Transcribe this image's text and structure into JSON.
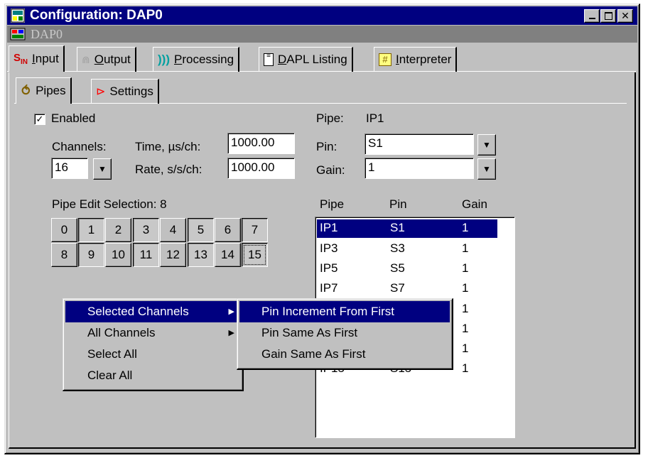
{
  "window": {
    "title": "Configuration: DAP0",
    "subtitle": "DAP0",
    "caption_buttons": [
      "minimize-icon",
      "maximize-icon",
      "close-icon"
    ]
  },
  "tabs": [
    {
      "prefix": "",
      "ul": "I",
      "rest": "nput"
    },
    {
      "prefix": "",
      "ul": "O",
      "rest": "utput"
    },
    {
      "prefix": "",
      "ul": "P",
      "rest": "rocessing"
    },
    {
      "prefix": "",
      "ul": "D",
      "rest": "APL Listing"
    },
    {
      "prefix": "",
      "ul": "I",
      "rest": "nterpreter"
    }
  ],
  "subtabs": [
    "Pipes",
    "Settings"
  ],
  "form": {
    "enabled_label": "Enabled",
    "enabled_checked": true,
    "channels_label": "Channels:",
    "channels_value": "16",
    "time_label": "Time, µs/ch:",
    "time_value": "1000.00",
    "rate_label": "Rate, s/s/ch:",
    "rate_value": "1000.00",
    "pipe_label": "Pipe:",
    "pipe_value": "IP1",
    "pin_label": "Pin:",
    "pin_value": "S1",
    "gain_label": "Gain:",
    "gain_value": "1"
  },
  "pipe_edit": {
    "label": "Pipe Edit Selection:",
    "count": "8",
    "buttons": [
      "0",
      "1",
      "2",
      "3",
      "4",
      "5",
      "6",
      "7",
      "8",
      "9",
      "10",
      "11",
      "12",
      "13",
      "14",
      "15"
    ]
  },
  "table": {
    "headers": [
      "Pipe",
      "Pin",
      "Gain"
    ],
    "rows": [
      {
        "pipe": "IP1",
        "pin": "S1",
        "gain": "1"
      },
      {
        "pipe": "IP3",
        "pin": "S3",
        "gain": "1"
      },
      {
        "pipe": "IP5",
        "pin": "S5",
        "gain": "1"
      },
      {
        "pipe": "IP7",
        "pin": "S7",
        "gain": "1"
      },
      {
        "pipe": "",
        "pin": "",
        "gain": "1"
      },
      {
        "pipe": "",
        "pin": "",
        "gain": "1"
      },
      {
        "pipe": "",
        "pin": "",
        "gain": "1"
      },
      {
        "pipe": "IP15",
        "pin": "S15",
        "gain": "1"
      }
    ]
  },
  "context_menu": {
    "items": [
      "Selected Channels",
      "All Channels",
      "Select All",
      "Clear All"
    ],
    "submenu": [
      "Pin Increment From First",
      "Pin Same As First",
      "Gain Same As First"
    ]
  }
}
